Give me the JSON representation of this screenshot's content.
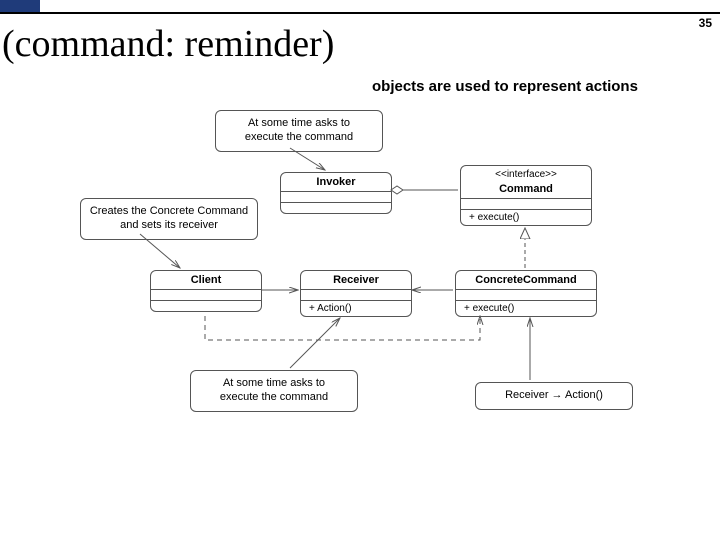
{
  "page_number": "35",
  "title": "(command: reminder)",
  "subtitle": "objects are used to represent actions",
  "notes": {
    "top": "At some time asks to\nexecute the command",
    "left": "Creates the Concrete Command\nand sets its receiver",
    "bottom": "At some time asks to\nexecute the command",
    "right": "Receiver → Action()"
  },
  "classes": {
    "invoker": {
      "name": "Invoker",
      "ops": ""
    },
    "command": {
      "stereo": "<<interface>>",
      "name": "Command",
      "ops": "+ execute()"
    },
    "client": {
      "name": "Client",
      "ops": ""
    },
    "receiver": {
      "name": "Receiver",
      "ops": "+ Action()"
    },
    "concrete": {
      "name": "ConcreteCommand",
      "ops": "+ execute()"
    }
  }
}
